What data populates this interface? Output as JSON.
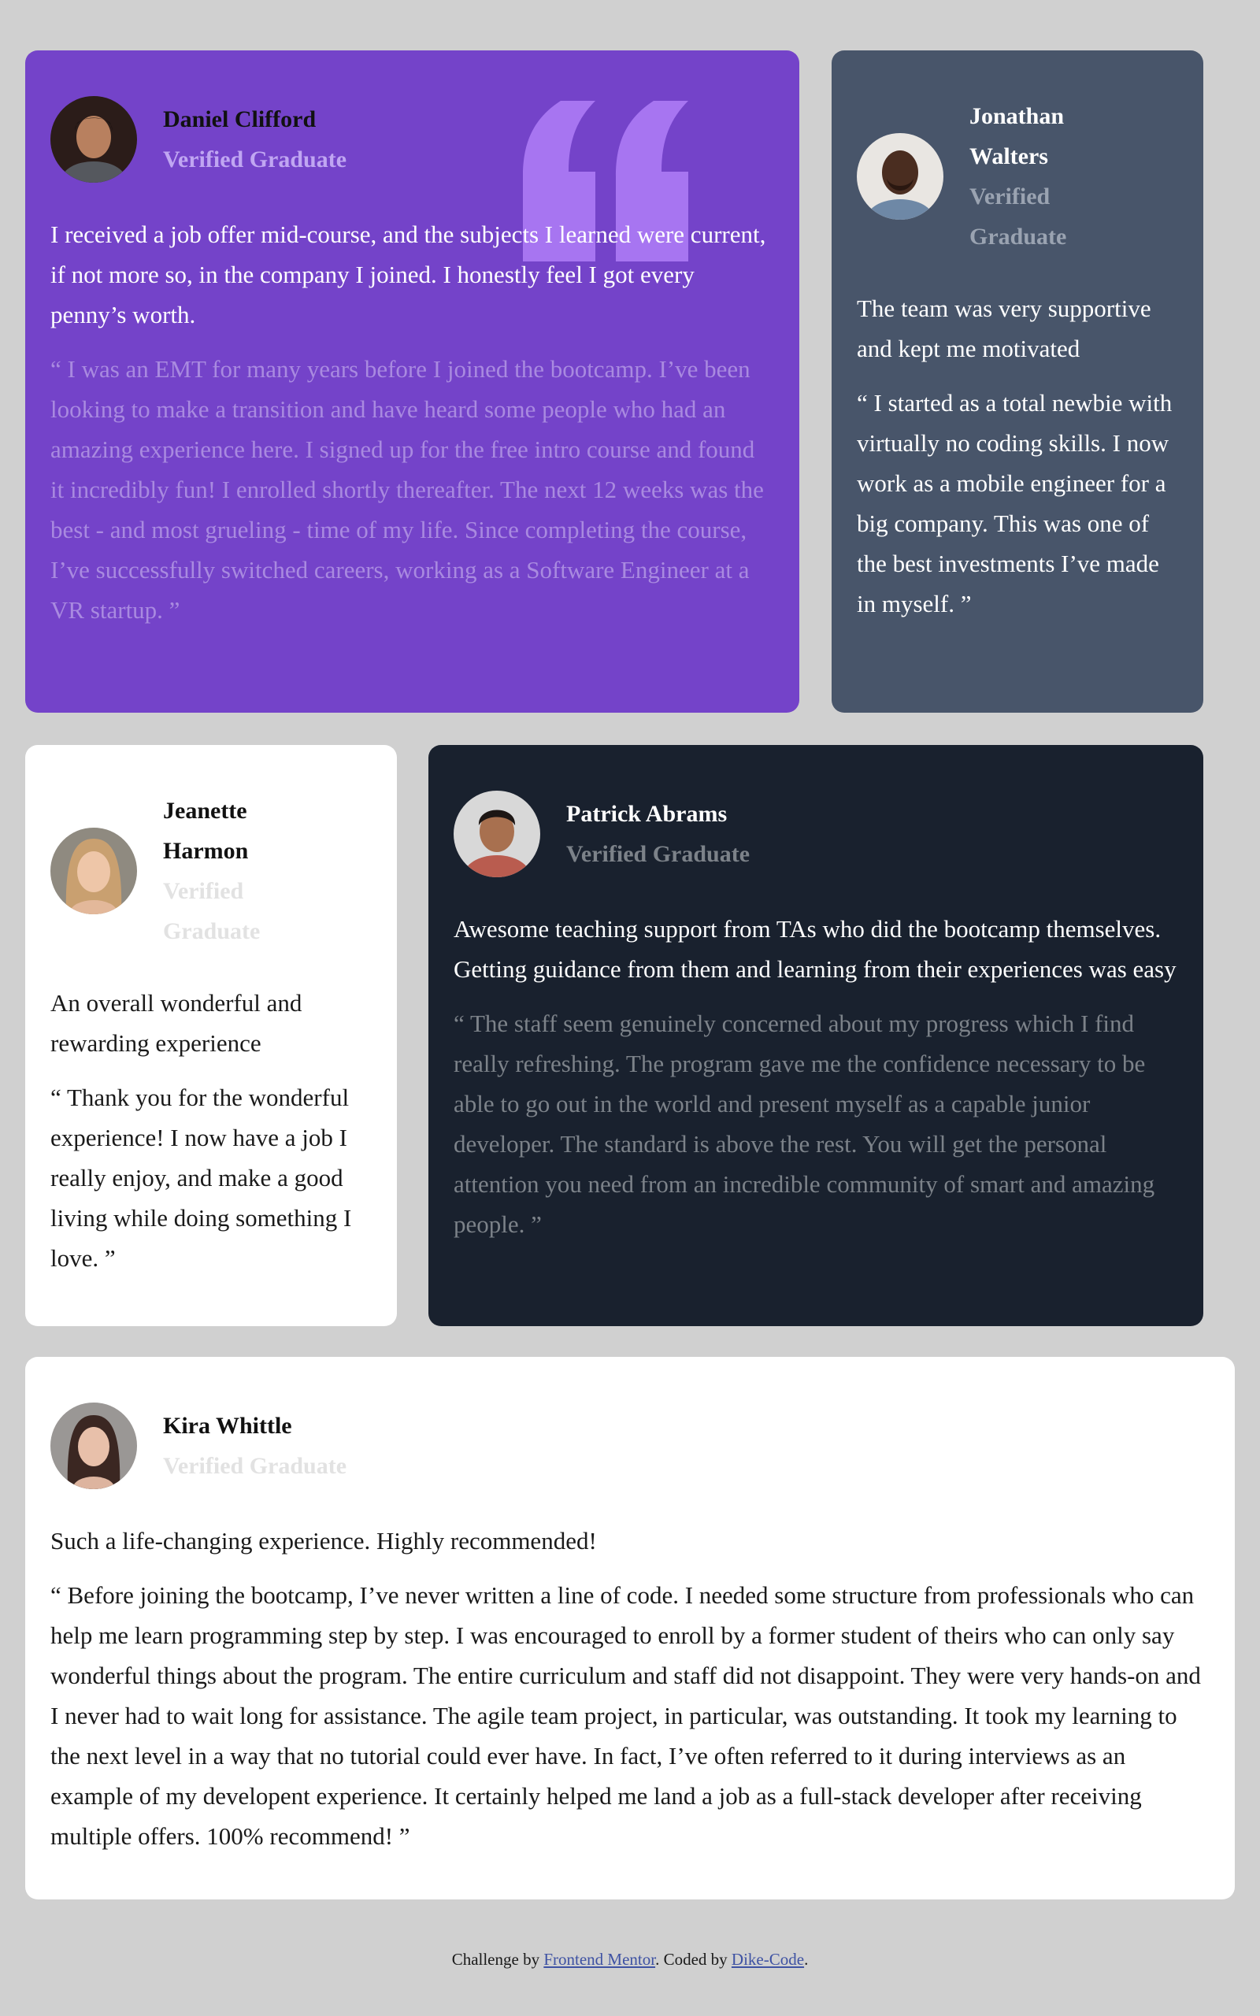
{
  "colors": {
    "page_background": "#d0d0d0",
    "accent_purple": "#7443c9",
    "slate_blue": "#48556a",
    "dark_navy": "#19212e",
    "white": "#ffffff",
    "link": "#3e52a3"
  },
  "testimonials": [
    {
      "name": "Daniel Clifford",
      "role": "Verified Graduate",
      "summary": "I received a job offer mid-course, and the subjects I learned were current, if not more so, in the company I joined. I honestly feel I got every penny’s worth.",
      "quote": "“ I was an EMT for many years before I joined the bootcamp. I’ve been looking to make a transition and have heard some people who had an amazing experience here. I signed up for the free intro course and found it incredibly fun! I enrolled shortly thereafter. The next 12 weeks was the best - and most grueling - time of my life. Since completing the course, I’ve successfully switched careers, working as a Software Engineer at a VR startup. ”",
      "decor_icon": "quotation-mark-icon"
    },
    {
      "name": "Jonathan Walters",
      "role": "Verified Graduate",
      "summary": "The team was very supportive and kept me motivated",
      "quote": "“ I started as a total newbie with virtually no coding skills. I now work as a mobile engineer for a big company. This was one of the best investments I’ve made in myself. ”"
    },
    {
      "name": "Jeanette Harmon",
      "role": "Verified Graduate",
      "summary": "An overall wonderful and rewarding experience",
      "quote": "“ Thank you for the wonderful experience! I now have a job I really enjoy, and make a good living while doing something I love. ”"
    },
    {
      "name": "Patrick Abrams",
      "role": "Verified Graduate",
      "summary": "Awesome teaching support from TAs who did the bootcamp themselves. Getting guidance from them and learning from their experiences was easy",
      "quote": "“ The staff seem genuinely concerned about my progress which I find really refreshing. The program gave me the confidence necessary to be able to go out in the world and present myself as a capable junior developer. The standard is above the rest. You will get the personal attention you need from an incredible community of smart and amazing people. ”"
    },
    {
      "name": "Kira Whittle",
      "role": "Verified Graduate",
      "summary": "Such a life-changing experience. Highly recommended!",
      "quote": "“ Before joining the bootcamp, I’ve never written a line of code. I needed some structure from professionals who can help me learn programming step by step. I was encouraged to enroll by a former student of theirs who can only say wonderful things about the program. The entire curriculum and staff did not disappoint. They were very hands-on and I never had to wait long for assistance. The agile team project, in particular, was outstanding. It took my learning to the next level in a way that no tutorial could ever have. In fact, I’ve often referred to it during interviews as an example of my developent experience. It certainly helped me land a job as a full-stack developer after receiving multiple offers. 100% recommend! ”"
    }
  ],
  "footer": {
    "prefix": "Challenge by ",
    "link1": "Frontend Mentor",
    "middle": ". Coded by ",
    "link2": "Dike-Code",
    "suffix": "."
  }
}
